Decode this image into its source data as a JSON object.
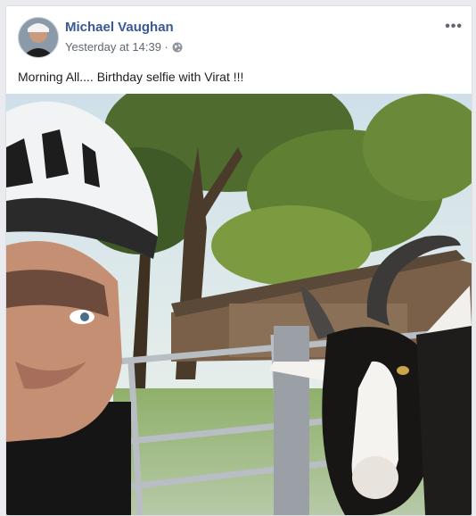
{
  "post": {
    "author_name": "Michael Vaughan",
    "timestamp": "Yesterday at 14:39 ·",
    "caption": "Morning All.... Birthday selfie with Virat !!!",
    "more_options_label": "•••",
    "privacy_icon": "globe-icon"
  },
  "colors": {
    "author_link": "#385898",
    "meta_text": "#616770",
    "body_text": "#1c1e21"
  }
}
